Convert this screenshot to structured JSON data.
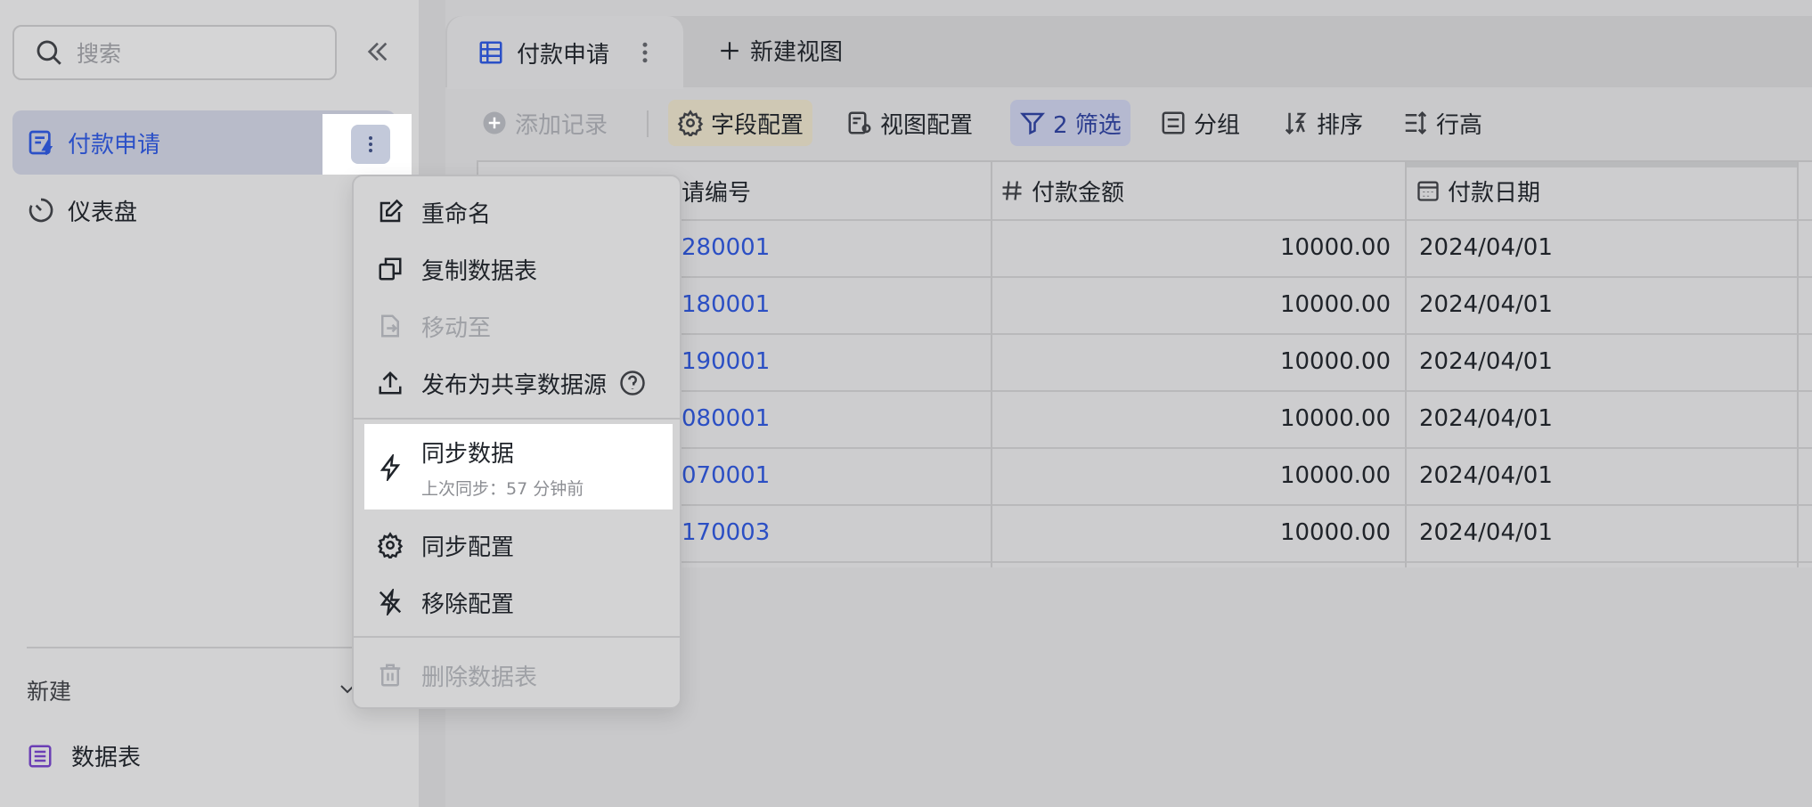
{
  "sidebar": {
    "search_placeholder": "搜索",
    "items": [
      {
        "label": "付款申请",
        "active": true
      },
      {
        "label": "仪表盘",
        "active": false
      }
    ],
    "new_label": "新建",
    "new_items": [
      {
        "label": "数据表"
      }
    ]
  },
  "tabs": {
    "active_label": "付款申请",
    "new_view_label": "新建视图"
  },
  "toolbar": {
    "add_record": "添加记录",
    "field_config": "字段配置",
    "view_config": "视图配置",
    "filter": "2 筛选",
    "group": "分组",
    "sort": "排序",
    "row_height": "行高"
  },
  "table": {
    "columns": [
      "请编号",
      "付款金额",
      "付款日期"
    ],
    "rows": [
      [
        "280001",
        "10000.00",
        "2024/04/01"
      ],
      [
        "180001",
        "10000.00",
        "2024/04/01"
      ],
      [
        "190001",
        "10000.00",
        "2024/04/01"
      ],
      [
        "080001",
        "10000.00",
        "2024/04/01"
      ],
      [
        "070001",
        "10000.00",
        "2024/04/01"
      ],
      [
        "170003",
        "10000.00",
        "2024/04/01"
      ]
    ]
  },
  "menu": {
    "rename": "重命名",
    "copy_table": "复制数据表",
    "move_to": "移动至",
    "publish": "发布为共享数据源",
    "sync_data": "同步数据",
    "last_sync": "上次同步：57 分钟前",
    "sync_config": "同步配置",
    "remove_config": "移除配置",
    "delete_table": "删除数据表"
  },
  "colors": {
    "accent_blue": "#2b50c7",
    "active_bg": "#b8bbc9",
    "filter_bg": "#b5b9d0",
    "field_bg": "#cfc8b4"
  }
}
